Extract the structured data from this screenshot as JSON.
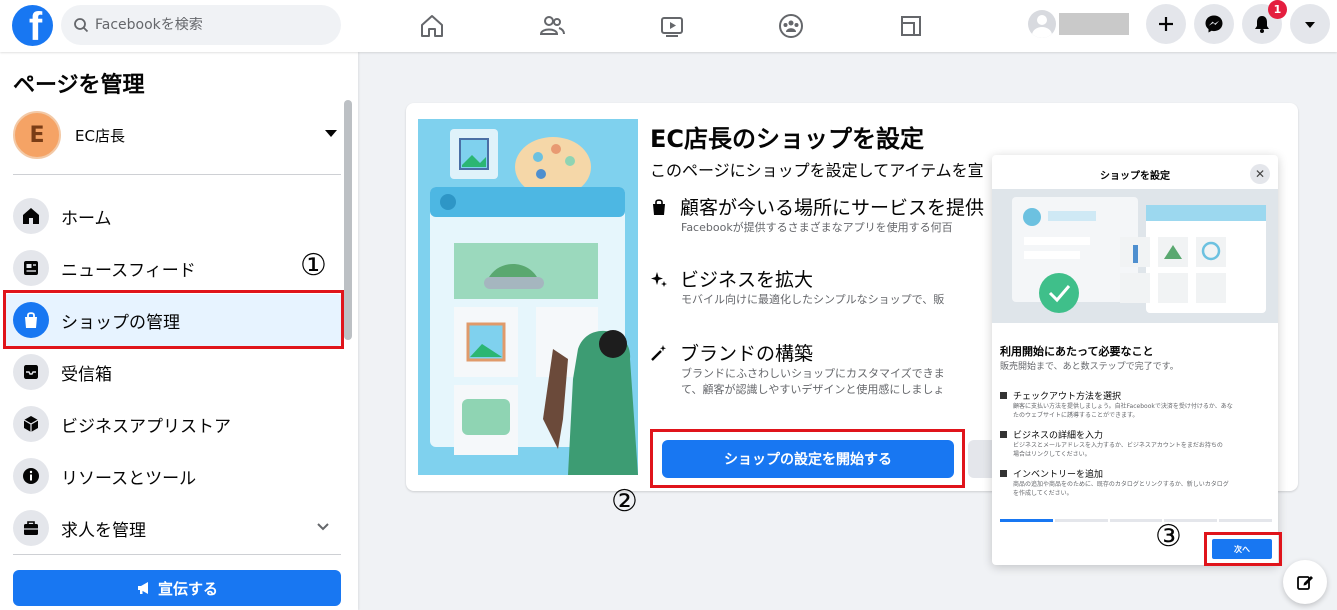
{
  "topbar": {
    "logo_letter": "f",
    "search_placeholder": "Facebookを検索",
    "notification_count": "1",
    "nav": [
      "home-icon",
      "friends-icon",
      "watch-icon",
      "groups-icon",
      "gaming-icon"
    ]
  },
  "sidebar": {
    "title": "ページを管理",
    "page_initial": "E",
    "page_name": "EC店長",
    "items": [
      {
        "label": "ホーム",
        "icon": "home-icon"
      },
      {
        "label": "ニュースフィード",
        "icon": "newsfeed-icon"
      },
      {
        "label": "ショップの管理",
        "icon": "shop-bag-icon"
      },
      {
        "label": "受信箱",
        "icon": "inbox-icon"
      },
      {
        "label": "ビジネスアプリストア",
        "icon": "cube-icon"
      },
      {
        "label": "リソースとツール",
        "icon": "info-icon"
      },
      {
        "label": "求人を管理",
        "icon": "briefcase-icon"
      }
    ],
    "promote_label": "宣伝する"
  },
  "annotations": {
    "one": "①",
    "two": "②",
    "three": "③"
  },
  "card": {
    "title": "EC店長のショップを設定",
    "subtitle": "このページにショップを設定してアイテムを宣",
    "features": [
      {
        "title": "顧客が今いる場所にサービスを提供",
        "desc": [
          "Facebookが提供するさまざまなアプリを使用する何百"
        ]
      },
      {
        "title": "ビジネスを拡大",
        "desc": [
          "モバイル向けに最適化したシンプルなショップで、販"
        ]
      },
      {
        "title": "ブランドの構築",
        "desc": [
          "ブランドにふさわしいショップにカスタマイズできま",
          "て、顧客が認識しやすいデザインと使用感にしましょ"
        ]
      }
    ],
    "start_label": "ショップの設定を開始する"
  },
  "dialog": {
    "title": "ショップを設定",
    "heading": "利用開始にあたって必要なこと",
    "sub": "販売開始まで、あと数ステップで完了です。",
    "items": [
      {
        "title": "チェックアウト方法を選択",
        "desc": [
          "顧客に支払い方法を提供しましょう。自社Facebookで決済を受け付けるか、あな",
          "たのウェブサイトに誘導することができます。"
        ]
      },
      {
        "title": "ビジネスの詳細を入力",
        "desc": [
          "ビジネスとメールアドレスを入力するか、ビジネスアカウントをまだお持ちの",
          "場合はリンクしてください。"
        ]
      },
      {
        "title": "インベントリーを追加",
        "desc": [
          "商品の追加や商品をのために、既存のカタログとリンクするか、新しいカタログ",
          "を作成してください。"
        ]
      }
    ],
    "next_label": "次へ"
  },
  "colors": {
    "brand": "#1877f2",
    "highlight": "#e0141b"
  }
}
